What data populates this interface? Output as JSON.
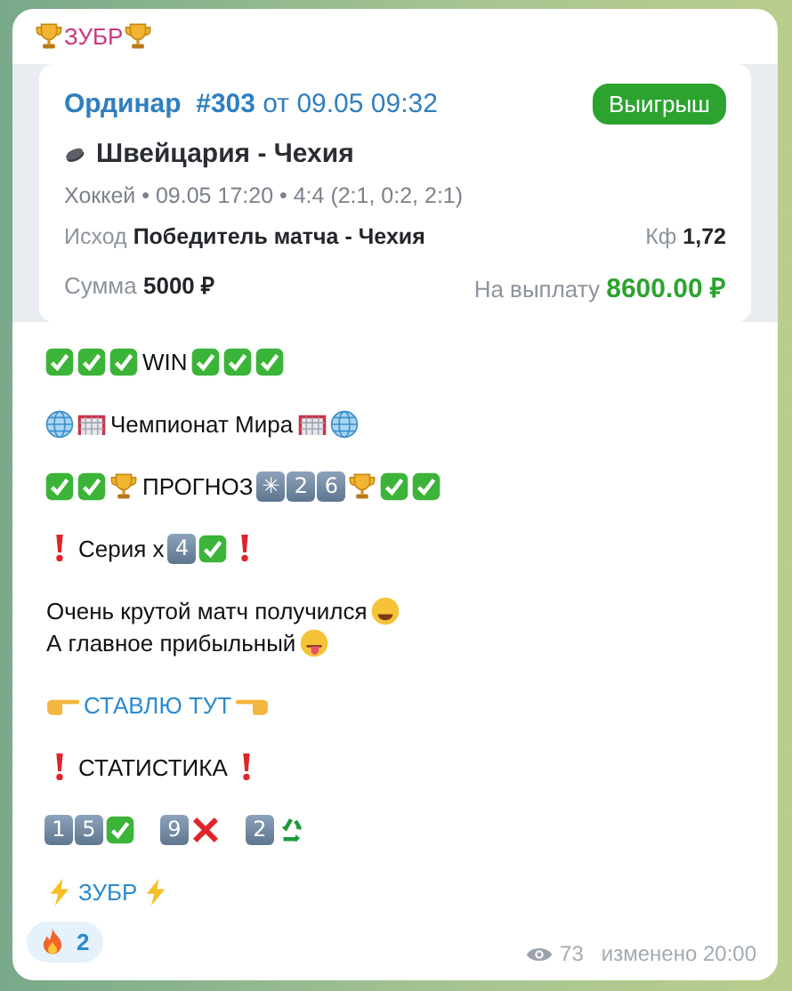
{
  "sender": [
    {
      "kind": "trophy"
    },
    {
      "kind": "text",
      "text": "ЗУБР"
    },
    {
      "kind": "trophy"
    }
  ],
  "bet_card": {
    "type": "Ординар",
    "number": "#303",
    "date_prefix": "от",
    "date": "09.05 09:32",
    "status": {
      "label": "Выигрыш",
      "kind": "win"
    },
    "match": "Швейцария - Чехия",
    "info": "Хоккей • 09.05 17:20 • 4:4 (2:1, 0:2, 2:1)",
    "outcome_label": "Исход",
    "outcome": "Победитель матча - Чехия",
    "odds_label": "Кф",
    "odds": "1,72",
    "stake_label": "Сумма",
    "stake": "5000 ₽",
    "payout_label": "На выплату",
    "payout": "8600.00 ₽"
  },
  "paragraphs": [
    {
      "lines": [
        [
          {
            "kind": "check"
          },
          {
            "kind": "check"
          },
          {
            "kind": "check"
          },
          {
            "kind": "text",
            "text": "WIN"
          },
          {
            "kind": "check"
          },
          {
            "kind": "check"
          },
          {
            "kind": "check"
          }
        ]
      ]
    },
    {
      "lines": [
        [
          {
            "kind": "globe"
          },
          {
            "kind": "net"
          },
          {
            "kind": "text",
            "text": "Чемпионат Мира"
          },
          {
            "kind": "net"
          },
          {
            "kind": "globe"
          }
        ]
      ]
    },
    {
      "lines": [
        [
          {
            "kind": "check"
          },
          {
            "kind": "check"
          },
          {
            "kind": "trophy"
          },
          {
            "kind": "text",
            "text": "ПРОГНОЗ"
          },
          {
            "kind": "key",
            "text": "✳"
          },
          {
            "kind": "key",
            "text": "2"
          },
          {
            "kind": "key",
            "text": "6"
          },
          {
            "kind": "trophy"
          },
          {
            "kind": "check"
          },
          {
            "kind": "check"
          }
        ]
      ]
    },
    {
      "lines": [
        [
          {
            "kind": "exclaim"
          },
          {
            "kind": "text",
            "text": "Серия х"
          },
          {
            "kind": "key",
            "text": "4"
          },
          {
            "kind": "check"
          },
          {
            "kind": "exclaim"
          }
        ]
      ]
    },
    {
      "lines": [
        [
          {
            "kind": "text",
            "text": "Очень крутой матч получился"
          },
          {
            "kind": "starstruck"
          }
        ],
        [
          {
            "kind": "text",
            "text": "А главное прибыльный"
          },
          {
            "kind": "wink"
          }
        ]
      ]
    },
    {
      "lines": [
        [
          {
            "kind": "point_right"
          },
          {
            "kind": "link",
            "text": "СТАВЛЮ ТУТ"
          },
          {
            "kind": "point_left"
          }
        ]
      ]
    },
    {
      "lines": [
        [
          {
            "kind": "exclaim"
          },
          {
            "kind": "text",
            "text": "СТАТИСТИКА"
          },
          {
            "kind": "exclaim"
          }
        ]
      ]
    },
    {
      "lines": [
        [
          {
            "kind": "key",
            "text": "1"
          },
          {
            "kind": "key",
            "text": "5"
          },
          {
            "kind": "check"
          },
          {
            "kind": "space"
          },
          {
            "kind": "key",
            "text": "9"
          },
          {
            "kind": "cross"
          },
          {
            "kind": "space"
          },
          {
            "kind": "key",
            "text": "2"
          },
          {
            "kind": "recycle"
          }
        ]
      ]
    },
    {
      "lines": [
        [
          {
            "kind": "bolt"
          },
          {
            "kind": "link",
            "text": "ЗУБР"
          },
          {
            "kind": "bolt"
          }
        ]
      ]
    }
  ],
  "reactions": [
    {
      "kind": "fire",
      "count": "2"
    }
  ],
  "footer": {
    "views": "73",
    "edited": "изменено 20:00"
  }
}
